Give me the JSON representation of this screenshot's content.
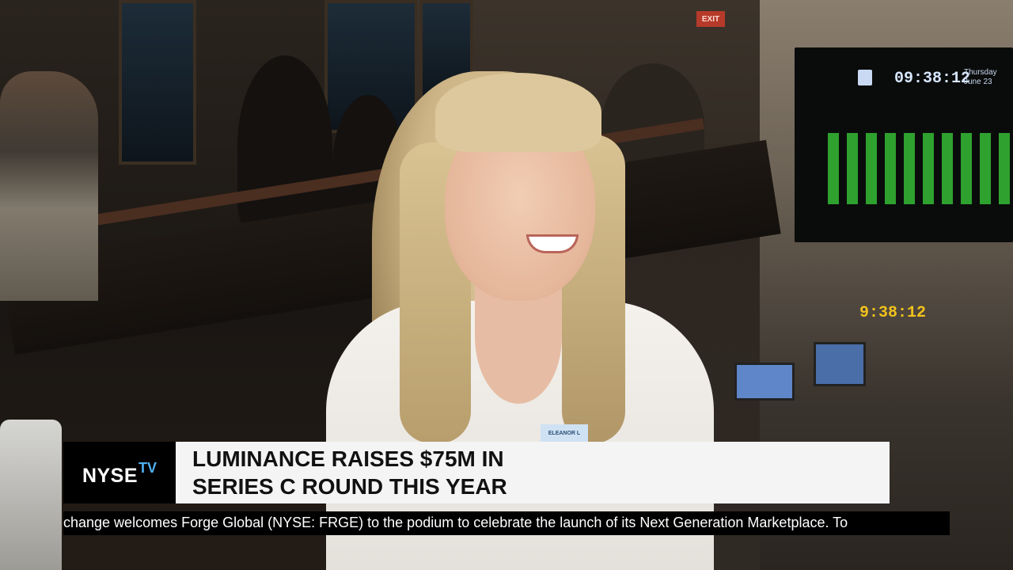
{
  "network_logo": {
    "name": "NYSE",
    "super": "TV"
  },
  "headline": {
    "line1": "LUMINANCE RAISES $75M IN",
    "line2": "SERIES C ROUND THIS YEAR"
  },
  "ticker": {
    "text": "change welcomes Forge Global (NYSE: FRGE) to the podium to celebrate the launch of its Next Generation Marketplace. To"
  },
  "scene": {
    "board_clock": "09:38:12",
    "board_day": "Thursday\nJune 23",
    "floor_clock": "9:38:12",
    "exit_sign": "EXIT",
    "name_tag": "ELEANOR L"
  },
  "colors": {
    "logo_accent": "#4fb0f0",
    "headline_bg": "#f4f4f4",
    "ticker_bg": "#000000"
  }
}
